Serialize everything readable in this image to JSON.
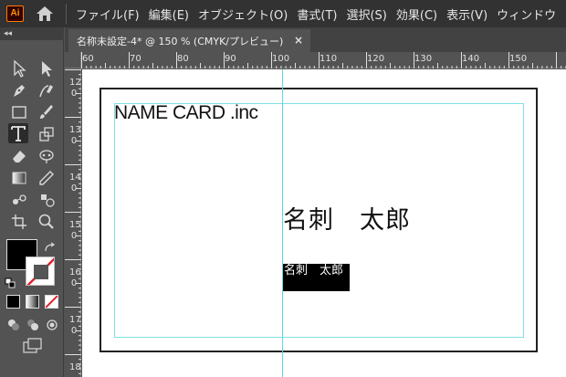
{
  "app": {
    "logo_text": "Ai",
    "menu": [
      "ファイル(F)",
      "編集(E)",
      "オブジェクト(O)",
      "書式(T)",
      "選択(S)",
      "効果(C)",
      "表示(V)",
      "ウィンドウ"
    ]
  },
  "panel": {
    "collapse_label": "◂◂"
  },
  "document": {
    "tab_title": "名称未設定-4* @ 150 % (CMYK/プレビュー)",
    "close_glyph": "×"
  },
  "rulers": {
    "horizontal": [
      "60",
      "70",
      "80",
      "90",
      "100",
      "110",
      "120",
      "130",
      "140",
      "150"
    ],
    "vertical": [
      "12\n0",
      "13\n0",
      "14\n0",
      "15\n0",
      "16\n0",
      "17\n0",
      "18"
    ]
  },
  "artwork": {
    "company": "NAME CARD .inc",
    "name_large": "名刺　太郎",
    "name_small": "名刺　太郎"
  },
  "colors": {
    "fill": "#000000",
    "stroke": "none",
    "guide": "#5fd6dc",
    "accent": "#ff7c00"
  }
}
